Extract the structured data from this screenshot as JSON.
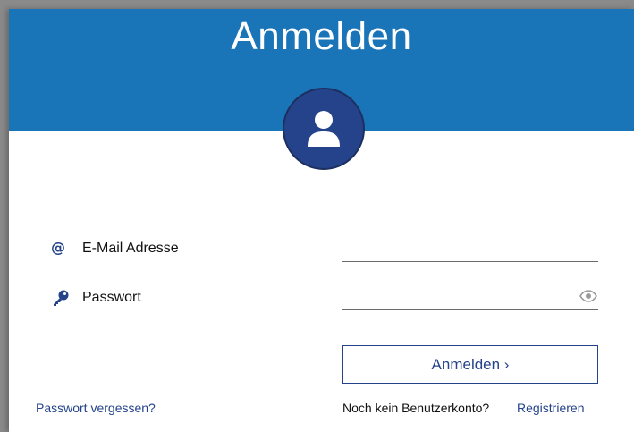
{
  "header": {
    "title": "Anmelden"
  },
  "avatar": {
    "icon": "user-icon"
  },
  "form": {
    "email": {
      "label": "E-Mail Adresse",
      "icon": "at-icon",
      "value": ""
    },
    "password": {
      "label": "Passwort",
      "icon": "key-icon",
      "value": "",
      "toggle_icon": "eye-icon"
    },
    "submit_label": "Anmelden ›"
  },
  "footer": {
    "forgot_password": "Passwort vergessen?",
    "no_account_text": "Noch kein Benutzerkonto?",
    "register_link": "Registrieren"
  },
  "colors": {
    "header": "#1a74b8",
    "accent": "#25438b"
  }
}
